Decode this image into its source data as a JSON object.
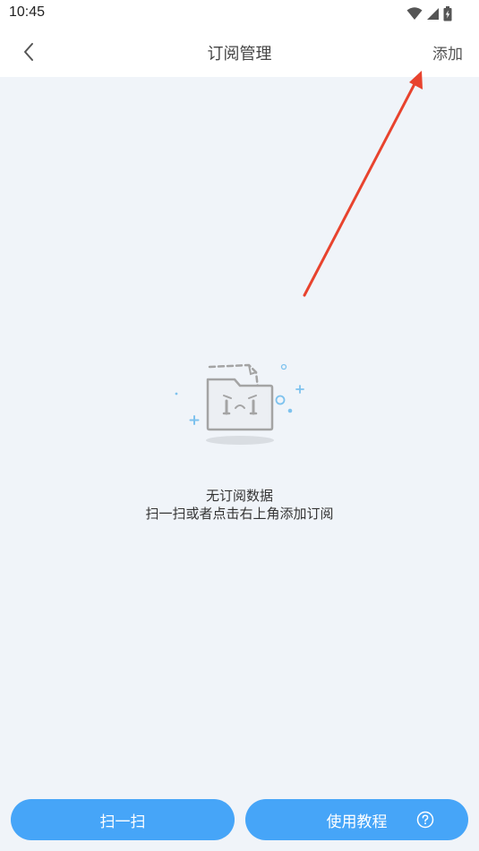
{
  "status_bar": {
    "time": "10:45",
    "icons": [
      "wifi-icon",
      "cellular-signal-icon",
      "battery-charging-icon"
    ]
  },
  "nav": {
    "back_icon": "chevron-left-icon",
    "title": "订阅管理",
    "add_label": "添加"
  },
  "empty_state": {
    "illustration": "empty-folder-crying-icon",
    "title": "无订阅数据",
    "hint": "扫一扫或者点击右上角添加订阅"
  },
  "bottom_actions": {
    "scan_label": "扫一扫",
    "tutorial_label": "使用教程",
    "tutorial_icon": "question-circle-icon"
  },
  "colors": {
    "page_background": "#f0f4f9",
    "header_background": "#ffffff",
    "primary_button": "#46a5f8",
    "annotation_arrow": "#e8432e",
    "illustration_accent": "#7ec2ee",
    "illustration_gray": "#a4a4a4"
  }
}
